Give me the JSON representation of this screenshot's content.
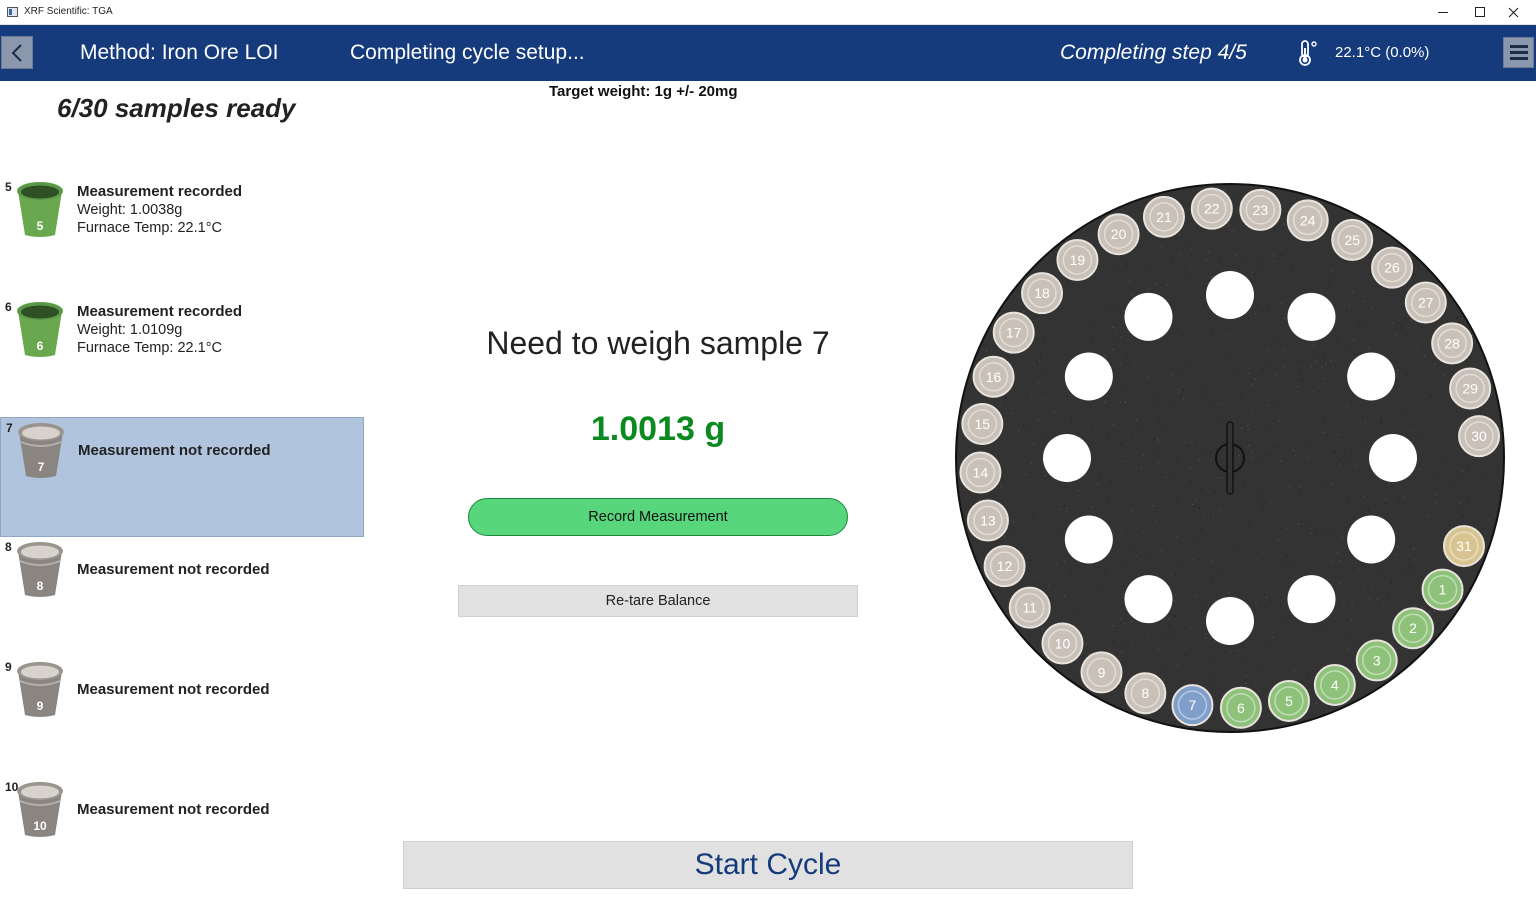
{
  "window": {
    "title": "XRF Scientific: TGA"
  },
  "header": {
    "method_title": "Method: Iron Ore LOI",
    "setup_status": "Completing cycle setup...",
    "step_status": "Completing step 4/5",
    "temperature": "22.1°C (0.0%)"
  },
  "left": {
    "samples_ready": "6/30 samples ready",
    "samples": [
      {
        "num": "5",
        "status": "Measurement recorded",
        "weight": "Weight: 1.0038g",
        "furnace_temp": "Furnace Temp: 22.1°C",
        "state": "recorded"
      },
      {
        "num": "6",
        "status": "Measurement recorded",
        "weight": "Weight: 1.0109g",
        "furnace_temp": "Furnace Temp: 22.1°C",
        "state": "recorded"
      },
      {
        "num": "7",
        "status": "Measurement not recorded",
        "state": "pending",
        "selected": true
      },
      {
        "num": "8",
        "status": "Measurement not recorded",
        "state": "pending"
      },
      {
        "num": "9",
        "status": "Measurement not recorded",
        "state": "pending"
      },
      {
        "num": "10",
        "status": "Measurement not recorded",
        "state": "pending"
      }
    ]
  },
  "center": {
    "target_weight": "Target weight: 1g +/- 20mg",
    "prompt": "Need to weigh sample 7",
    "live_weight": "1.0013 g",
    "record_label": "Record Measurement",
    "retare_label": "Re-tare Balance",
    "start_label": "Start Cycle"
  },
  "carousel": {
    "positions": [
      "1",
      "2",
      "3",
      "4",
      "5",
      "6",
      "7",
      "8",
      "9",
      "10",
      "11",
      "12",
      "13",
      "14",
      "15",
      "16",
      "17",
      "18",
      "19",
      "20",
      "21",
      "22",
      "23",
      "24",
      "25",
      "26",
      "27",
      "28",
      "29",
      "30",
      "31"
    ],
    "states": {
      "1": "done",
      "2": "done",
      "3": "done",
      "4": "done",
      "5": "done",
      "6": "done",
      "7": "current",
      "31": "reference"
    },
    "colors": {
      "done": "#8ec27a",
      "current": "#7f9fca",
      "reference": "#d8c490",
      "empty": "#c9c1b8",
      "plate": "#333333"
    }
  }
}
